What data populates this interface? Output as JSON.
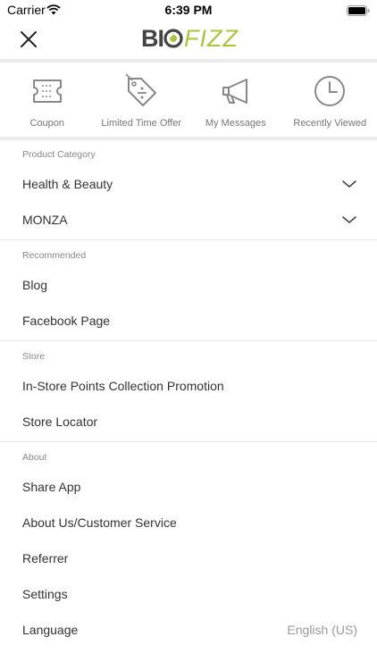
{
  "status_bar": {
    "carrier": "Carrier",
    "time": "6:39 PM"
  },
  "header": {
    "logo_bio": "BI",
    "logo_fizz": "FIZZ",
    "brand_color": "#a8c63c"
  },
  "quick_actions": [
    {
      "label": "Coupon",
      "icon": "ticket-icon"
    },
    {
      "label": "Limited Time Offer",
      "icon": "discount-tag-icon"
    },
    {
      "label": "My Messages",
      "icon": "megaphone-icon"
    },
    {
      "label": "Recently Viewed",
      "icon": "clock-icon"
    }
  ],
  "sections": {
    "product_category": {
      "title": "Product Category",
      "items": [
        "Health & Beauty",
        "MONZA"
      ]
    },
    "recommended": {
      "title": "Recommended",
      "items": [
        "Blog",
        "Facebook Page"
      ]
    },
    "store": {
      "title": "Store",
      "items": [
        "In-Store Points Collection Promotion",
        "Store Locator"
      ]
    },
    "about": {
      "title": "About",
      "items": [
        "Share App",
        "About Us/Customer Service",
        "Referrer",
        "Settings",
        "Language"
      ],
      "language_value": "English (US)"
    }
  }
}
